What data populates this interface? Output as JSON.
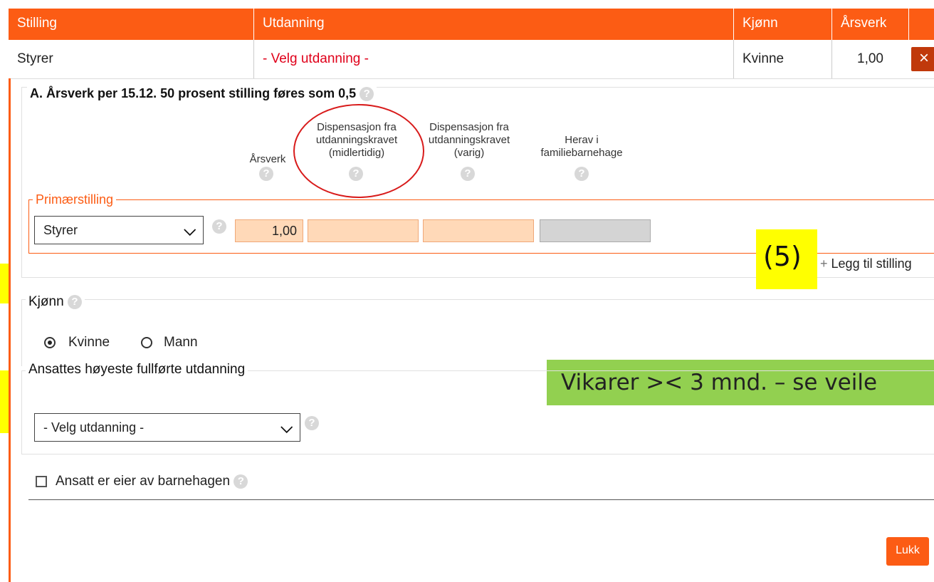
{
  "table": {
    "headers": [
      "Stilling",
      "Utdanning",
      "Kjønn",
      "Årsverk"
    ],
    "row": {
      "stilling": "Styrer",
      "utdanning": "- Velg utdanning -",
      "kjonn": "Kvinne",
      "arsverk": "1,00"
    },
    "delete_icon": "close-icon"
  },
  "section_a": {
    "title": "A. Årsverk per 15.12. 50 prosent stilling føres som 0,5",
    "columns": {
      "c1": "Årsverk",
      "c2": "Dispensasjon fra utdanningskravet (midlertidig)",
      "c3": "Dispensasjon fra utdanningskravet (varig)",
      "c4": "Herav i familiebarnehage"
    },
    "primary": {
      "legend": "Primærstilling",
      "position_value": "Styrer",
      "arsverk_value": "1,00"
    },
    "add_link": "Legg til stilling"
  },
  "gender": {
    "legend": "Kjønn",
    "options": [
      "Kvinne",
      "Mann"
    ],
    "selected": "Kvinne"
  },
  "education": {
    "legend": "Ansattes høyeste fullførte utdanning",
    "selected": "- Velg utdanning -"
  },
  "owner": {
    "label": "Ansatt er eier av barnehagen",
    "checked": false
  },
  "buttons": {
    "close": "Lukk"
  },
  "help_symbol": "?",
  "annotations": {
    "badge": "(5)",
    "banner": "Vikarer >< 3 mnd. – se veile"
  },
  "colors": {
    "accent": "#fc5c14",
    "highlight": "#ffff00",
    "banner": "#92d050",
    "circle": "#d81b1b"
  }
}
